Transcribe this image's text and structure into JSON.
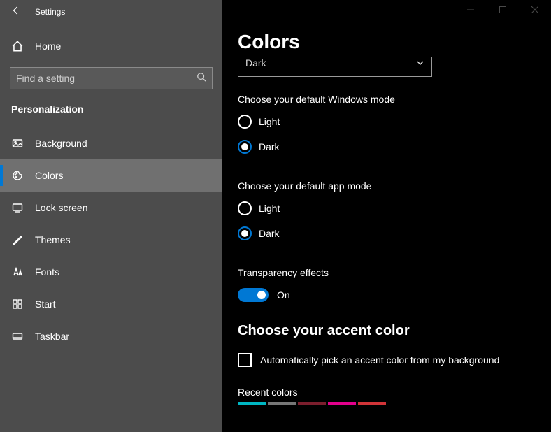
{
  "app": {
    "title": "Settings"
  },
  "sidebar": {
    "home_label": "Home",
    "search_placeholder": "Find a setting",
    "section_title": "Personalization",
    "items": [
      {
        "label": "Background",
        "icon": "picture-icon"
      },
      {
        "label": "Colors",
        "icon": "palette-icon",
        "active": true
      },
      {
        "label": "Lock screen",
        "icon": "lockscreen-icon"
      },
      {
        "label": "Themes",
        "icon": "brush-icon"
      },
      {
        "label": "Fonts",
        "icon": "fonts-icon"
      },
      {
        "label": "Start",
        "icon": "start-icon"
      },
      {
        "label": "Taskbar",
        "icon": "taskbar-icon"
      }
    ]
  },
  "main": {
    "page_title": "Colors",
    "mode_dropdown": {
      "value": "Dark"
    },
    "windows_mode": {
      "label": "Choose your default Windows mode",
      "options": [
        {
          "label": "Light",
          "checked": false
        },
        {
          "label": "Dark",
          "checked": true
        }
      ]
    },
    "app_mode": {
      "label": "Choose your default app mode",
      "options": [
        {
          "label": "Light",
          "checked": false
        },
        {
          "label": "Dark",
          "checked": true
        }
      ]
    },
    "transparency": {
      "label": "Transparency effects",
      "state_label": "On",
      "on": true
    },
    "accent": {
      "title": "Choose your accent color",
      "auto_checkbox_label": "Automatically pick an accent color from my background",
      "recent_label": "Recent colors",
      "recent_colors": [
        "#00b7c3",
        "#767676",
        "#7c1e2d",
        "#e3008c",
        "#d13438"
      ]
    }
  }
}
